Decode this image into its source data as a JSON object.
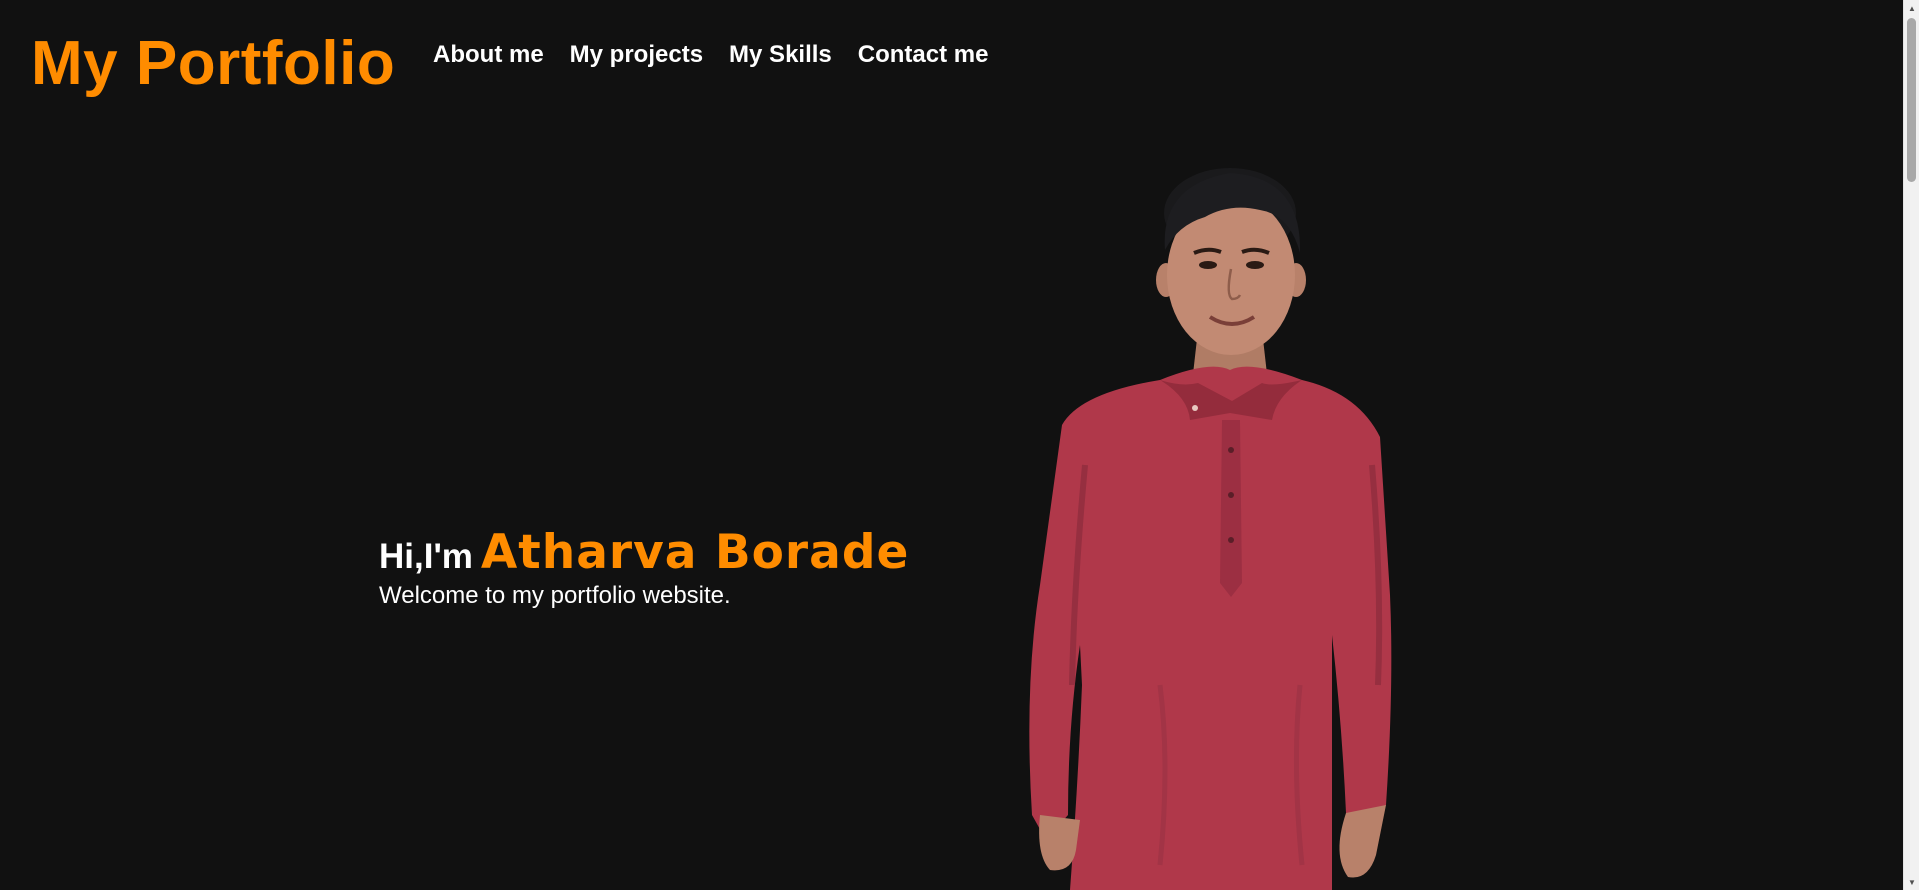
{
  "header": {
    "logo": "My Portfolio",
    "nav": [
      {
        "label": "About me"
      },
      {
        "label": "My projects"
      },
      {
        "label": "My Skills"
      },
      {
        "label": "Contact me"
      }
    ]
  },
  "hero": {
    "greeting": "Hi,I'm",
    "name": "Atharva Borade",
    "tagline": "Welcome to my portfolio website.",
    "portrait_icon": "person-portrait-photo"
  },
  "colors": {
    "background": "#111111",
    "accent": "#ff8c00",
    "text": "#ffffff",
    "kurta": "#b0384a"
  },
  "scrollbar": {
    "up_icon": "scroll-up-arrow-icon",
    "down_icon": "scroll-down-arrow-icon"
  }
}
